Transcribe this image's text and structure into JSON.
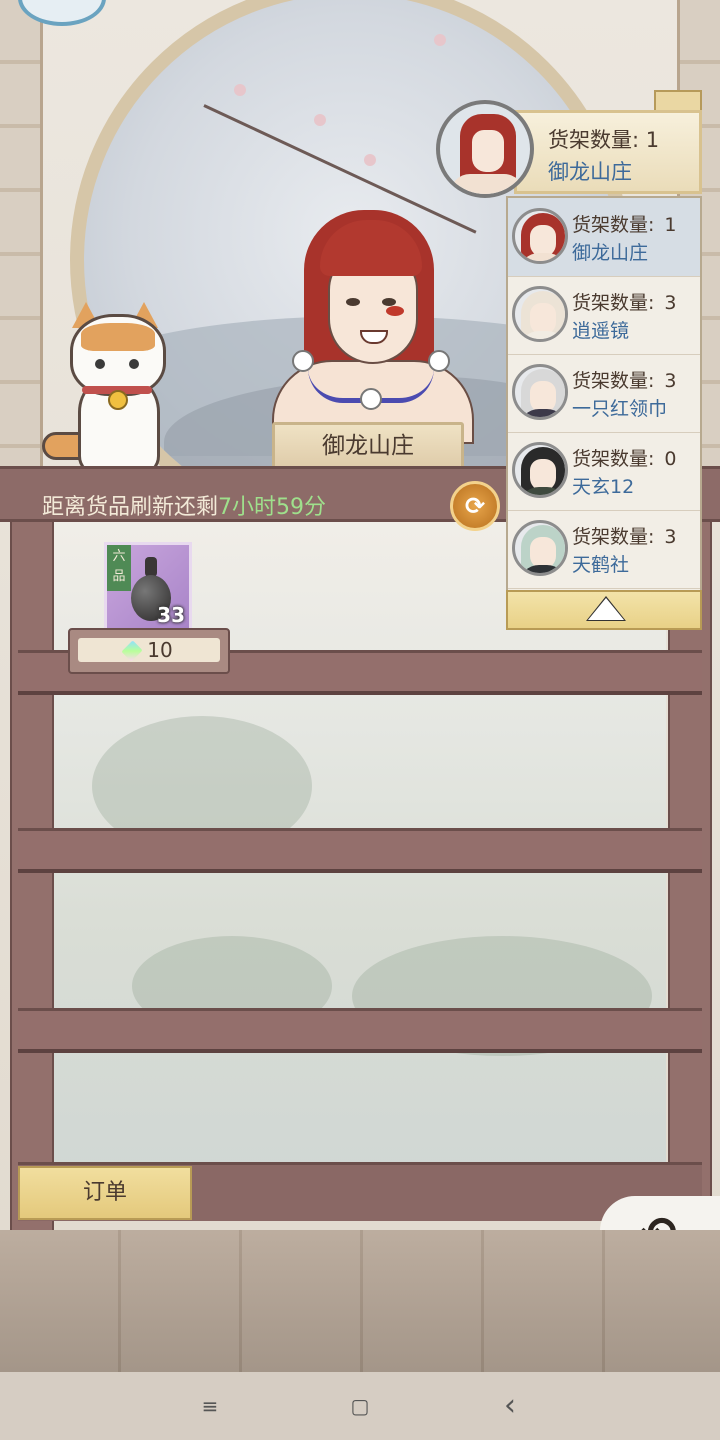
{
  "shop": {
    "keeper_name": "御龙山庄",
    "refresh_prefix": "距离货品刷新还剩",
    "refresh_time": "7小时59分",
    "refresh_icon": "refresh-arrows-icon"
  },
  "current_shelf": {
    "count_label": "货架数量:",
    "count_value": "1",
    "name": "御龙山庄"
  },
  "shelf_list": [
    {
      "count_label": "货架数量:",
      "count_value": "1",
      "name": "御龙山庄",
      "hair": "#a8332b",
      "outfit": "#f2e1d2",
      "active": true
    },
    {
      "count_label": "货架数量:",
      "count_value": "3",
      "name": "逍遥镜",
      "hair": "#ece3d6",
      "outfit": "#f1ece3",
      "active": false
    },
    {
      "count_label": "货架数量:",
      "count_value": "3",
      "name": "一只红领巾",
      "hair": "#d8d8d8",
      "outfit": "#3d3a4a",
      "active": false
    },
    {
      "count_label": "货架数量:",
      "count_value": "0",
      "name": "天玄12",
      "hair": "#2a2a2a",
      "outfit": "#3f4a3e",
      "active": false
    },
    {
      "count_label": "货架数量:",
      "count_value": "3",
      "name": "天鹤社",
      "hair": "#bcd3c8",
      "outfit": "#2e3236",
      "active": false
    }
  ],
  "items": [
    {
      "grade": "六品",
      "count": "33",
      "price": "10",
      "icon": "ink-vase-icon",
      "currency_icon": "spirit-gem-icon"
    }
  ],
  "buttons": {
    "order": "订单",
    "back_icon": "back-arrow-icon",
    "collapse_icon": "triangle-up-icon"
  },
  "system_nav": {
    "menu": "≡",
    "home": "▢",
    "back": "‹"
  }
}
